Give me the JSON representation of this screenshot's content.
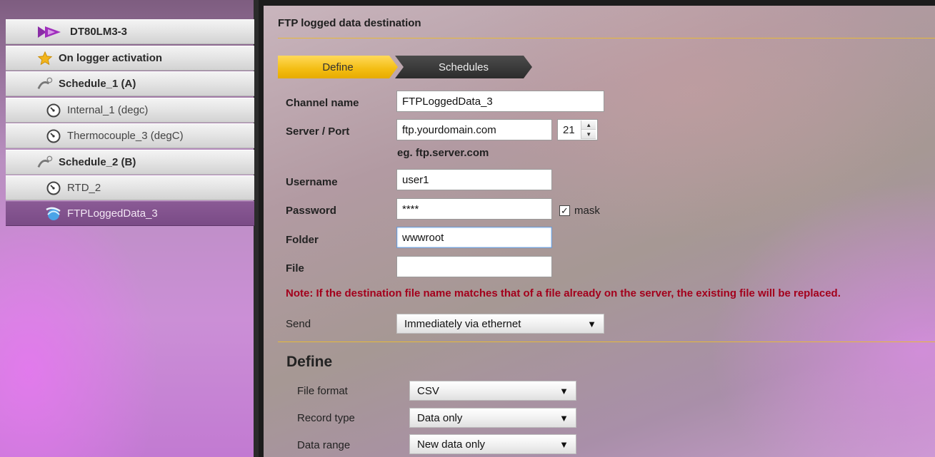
{
  "sidebar": {
    "items": [
      {
        "label": "DT80LM3-3",
        "icon": "datataker-logo-icon"
      },
      {
        "label": "On logger activation",
        "icon": "star-icon"
      },
      {
        "label": "Schedule_1 (A)",
        "icon": "schedule-icon"
      },
      {
        "label": "Internal_1 (degc)",
        "icon": "gauge-icon"
      },
      {
        "label": "Thermocouple_3 (degC)",
        "icon": "gauge-icon"
      },
      {
        "label": "Schedule_2 (B)",
        "icon": "schedule-icon"
      },
      {
        "label": "RTD_2",
        "icon": "gauge-icon"
      },
      {
        "label": "FTPLoggedData_3",
        "icon": "ftp-globe-icon"
      }
    ]
  },
  "panel": {
    "title": "FTP logged data destination",
    "tabs": {
      "define": "Define",
      "schedules": "Schedules"
    },
    "active_tab": "Define",
    "accent_color": "#f3bd12",
    "warning_color": "#a3001c",
    "form": {
      "channel_name_label": "Channel name",
      "channel_name_value": "FTPLoggedData_3",
      "server_port_label": "Server / Port",
      "server_value": "ftp.yourdomain.com",
      "port_value": "21",
      "server_hint": "eg. ftp.server.com",
      "username_label": "Username",
      "username_value": "user1",
      "password_label": "Password",
      "password_value": "****",
      "mask_label": "mask",
      "mask_checked": true,
      "folder_label": "Folder",
      "folder_value": "wwwroot",
      "file_label": "File",
      "file_value": "",
      "note": "Note: If the destination file name matches that of a file already on the server, the existing file will be replaced.",
      "send_label": "Send",
      "send_value": "Immediately via ethernet"
    },
    "define_section": {
      "title": "Define",
      "file_format_label": "File format",
      "file_format_value": "CSV",
      "record_type_label": "Record type",
      "record_type_value": "Data only",
      "data_range_label": "Data range",
      "data_range_value": "New data only"
    }
  }
}
